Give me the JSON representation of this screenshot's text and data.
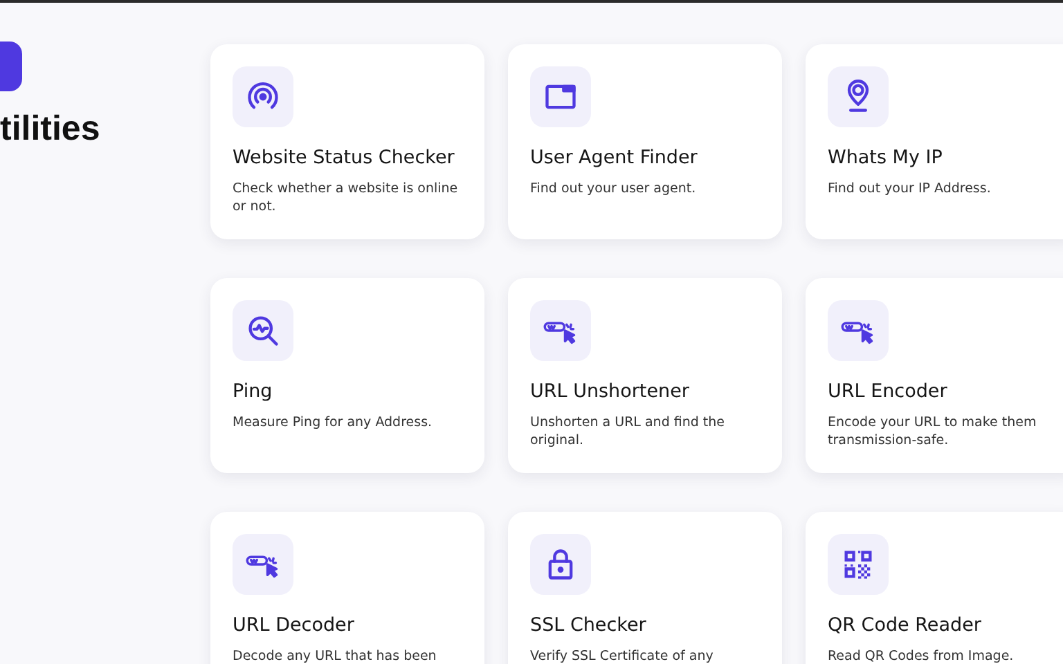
{
  "header": {
    "title": "tilities"
  },
  "tools": [
    {
      "kind": "signal",
      "title": "Website Status Checker",
      "description": "Check whether a website is online or not."
    },
    {
      "kind": "window",
      "title": "User Agent Finder",
      "description": "Find out your user agent."
    },
    {
      "kind": "pin",
      "title": "Whats My IP",
      "description": "Find out your IP Address."
    },
    {
      "kind": "search",
      "title": "Ping",
      "description": "Measure Ping for any Address."
    },
    {
      "kind": "link",
      "title": "URL Unshortener",
      "description": "Unshorten a URL and find the original."
    },
    {
      "kind": "link",
      "title": "URL Encoder",
      "description": "Encode your URL to make them transmission-safe."
    },
    {
      "kind": "link",
      "title": "URL Decoder",
      "description": "Decode any URL that has been"
    },
    {
      "kind": "lock",
      "title": "SSL Checker",
      "description": "Verify SSL Certificate of any"
    },
    {
      "kind": "qr",
      "title": "QR Code Reader",
      "description": "Read QR Codes from Image."
    }
  ]
}
